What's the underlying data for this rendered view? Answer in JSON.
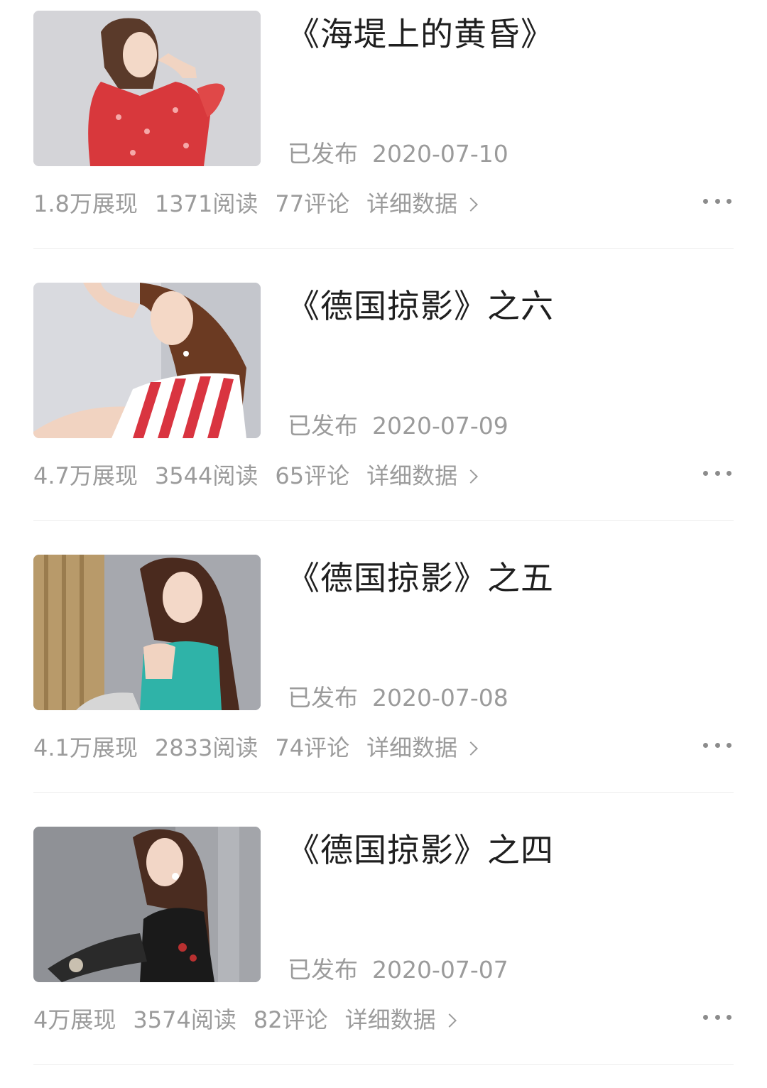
{
  "articles": [
    {
      "title": "《海堤上的黄昏》",
      "status": "已发布",
      "date": "2020-07-10",
      "impressions": "1.8万展现",
      "reads": "1371阅读",
      "comments": "77评论",
      "details_label": "详细数据",
      "thumbnail": "woman-red-floral-dress"
    },
    {
      "title": "《德国掠影》之六",
      "status": "已发布",
      "date": "2020-07-09",
      "impressions": "4.7万展现",
      "reads": "3544阅读",
      "comments": "65评论",
      "details_label": "详细数据",
      "thumbnail": "woman-red-striped-top"
    },
    {
      "title": "《德国掠影》之五",
      "status": "已发布",
      "date": "2020-07-08",
      "impressions": "4.1万展现",
      "reads": "2833阅读",
      "comments": "74评论",
      "details_label": "详细数据",
      "thumbnail": "woman-teal-lace-dress"
    },
    {
      "title": "《德国掠影》之四",
      "status": "已发布",
      "date": "2020-07-07",
      "impressions": "4万展现",
      "reads": "3574阅读",
      "comments": "82评论",
      "details_label": "详细数据",
      "thumbnail": "woman-black-lace-top"
    }
  ],
  "colors": {
    "title_text": "#1f1f1f",
    "muted_text": "#9b9b9b",
    "divider": "#ececec",
    "more_dots": "#8c8c8c"
  }
}
